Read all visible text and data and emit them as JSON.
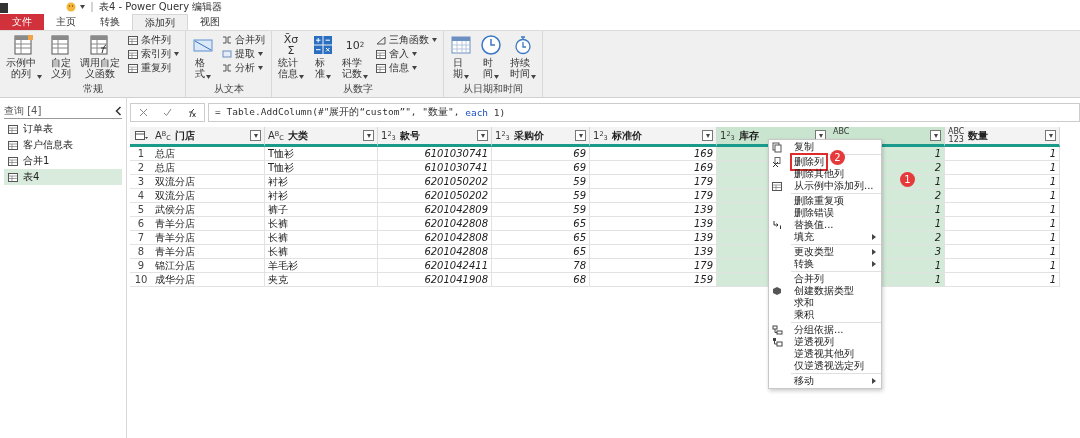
{
  "window": {
    "title": "表4 - Power Query 编辑器"
  },
  "tabs": [
    {
      "label": "文件",
      "kind": "file",
      "selected": false
    },
    {
      "label": "主页",
      "kind": "tab",
      "selected": false
    },
    {
      "label": "转换",
      "kind": "tab",
      "selected": false
    },
    {
      "label": "添加列",
      "kind": "tab",
      "selected": true
    },
    {
      "label": "视图",
      "kind": "tab",
      "selected": false
    }
  ],
  "ribbon": {
    "groups": [
      {
        "label": "常规",
        "large": [
          {
            "label": "示例中的列",
            "dropdown": true
          },
          {
            "label": "自定义列",
            "dropdown": false
          },
          {
            "label": "调用自定义函数",
            "dropdown": false
          }
        ],
        "small": [
          {
            "label": "条件列",
            "dropdown": false
          },
          {
            "label": "索引列",
            "dropdown": true
          },
          {
            "label": "重复列",
            "dropdown": false
          }
        ]
      },
      {
        "label": "从文本",
        "large": [
          {
            "label": "格式",
            "dropdown": true
          }
        ],
        "small": [
          {
            "label": "合并列",
            "dropdown": false
          },
          {
            "label": "提取",
            "dropdown": true
          },
          {
            "label": "分析",
            "dropdown": true
          }
        ]
      },
      {
        "label": "从数字",
        "large": [
          {
            "label": "统计信息",
            "icon_text": "X̄σ\nΣ",
            "dropdown": true
          },
          {
            "label": "标准",
            "dropdown": true
          },
          {
            "label": "科学记数",
            "icon_text": "10$^{2}$",
            "dropdown": true
          }
        ],
        "small": [
          {
            "label": "三角函数",
            "dropdown": true
          },
          {
            "label": "舍入",
            "dropdown": true
          },
          {
            "label": "信息",
            "dropdown": true
          }
        ]
      },
      {
        "label": "从日期和时间",
        "large": [
          {
            "label": "日期",
            "dropdown": true
          },
          {
            "label": "时间",
            "dropdown": true
          },
          {
            "label": "持续时间",
            "dropdown": true
          }
        ]
      }
    ]
  },
  "queries": {
    "title": "查询 [4]",
    "items": [
      {
        "label": "订单表",
        "selected": false
      },
      {
        "label": "客户信息表",
        "selected": false
      },
      {
        "label": "合并1",
        "selected": false
      },
      {
        "label": "表4",
        "selected": true
      }
    ]
  },
  "formula": [
    {
      "text": "= Table.AddColumn(#\"展开的“custom”\", \"数量\", ",
      "kind": "code"
    },
    {
      "text": "each",
      "kind": "keyword"
    },
    {
      "text": " 1)",
      "kind": "code"
    }
  ],
  "table": {
    "columns": [
      {
        "name": "门店",
        "type_label": "A$^{B}$$_{C}$",
        "kind": "text",
        "selected": false,
        "covered": false
      },
      {
        "name": "大类",
        "type_label": "A$^{B}$$_{C}$",
        "kind": "text",
        "selected": false,
        "covered": false
      },
      {
        "name": "款号",
        "type_label": "1$^{2}$$_{3}$",
        "kind": "number",
        "selected": false,
        "covered": false
      },
      {
        "name": "采购价",
        "type_label": "1$^{2}$$_{3}$",
        "kind": "number",
        "selected": false,
        "covered": false
      },
      {
        "name": "标准价",
        "type_label": "1$^{2}$$_{3}$",
        "kind": "number",
        "selected": false,
        "covered": false
      },
      {
        "name": "库存",
        "type_label": "1$^{2}$$_{3}$",
        "kind": "number",
        "selected": true,
        "covered": true
      },
      {
        "type_label": "ABC",
        "kind": "any",
        "selected": true,
        "covered": false
      },
      {
        "name": "数量",
        "type_label": "ABC\n123",
        "kind": "any",
        "selected": false,
        "covered": false
      }
    ],
    "rows": [
      {
        "n": "1",
        "cells": [
          "总店",
          "T恤衫",
          "6101030741",
          "69",
          "169",
          "1",
          "1"
        ]
      },
      {
        "n": "2",
        "cells": [
          "总店",
          "T恤衫",
          "6101030741",
          "69",
          "169",
          "2",
          "1"
        ]
      },
      {
        "n": "3",
        "cells": [
          "双流分店",
          "衬衫",
          "6201050202",
          "59",
          "179",
          "1",
          "1"
        ]
      },
      {
        "n": "4",
        "cells": [
          "双流分店",
          "衬衫",
          "6201050202",
          "59",
          "179",
          "2",
          "1"
        ]
      },
      {
        "n": "5",
        "cells": [
          "武侯分店",
          "裤子",
          "6201042809",
          "59",
          "139",
          "1",
          "1"
        ]
      },
      {
        "n": "6",
        "cells": [
          "青羊分店",
          "长裤",
          "6201042808",
          "65",
          "139",
          "1",
          "1"
        ]
      },
      {
        "n": "7",
        "cells": [
          "青羊分店",
          "长裤",
          "6201042808",
          "65",
          "139",
          "2",
          "1"
        ]
      },
      {
        "n": "8",
        "cells": [
          "青羊分店",
          "长裤",
          "6201042808",
          "65",
          "139",
          "3",
          "1"
        ]
      },
      {
        "n": "9",
        "cells": [
          "锦江分店",
          "羊毛衫",
          "6201042411",
          "78",
          "179",
          "1",
          "1"
        ]
      },
      {
        "n": "10",
        "cells": [
          "成华分店",
          "夹克",
          "6201041908",
          "68",
          "159",
          "1",
          "1"
        ]
      }
    ]
  },
  "context_menu": [
    {
      "kind": "item",
      "label": "复制",
      "submenu": false,
      "highlighted": false
    },
    {
      "kind": "separator"
    },
    {
      "kind": "item",
      "label": "删除列",
      "submenu": false,
      "highlighted": true
    },
    {
      "kind": "item",
      "label": "删除其他列",
      "submenu": false,
      "highlighted": false
    },
    {
      "kind": "item",
      "label": "从示例中添加列...",
      "submenu": false,
      "highlighted": false
    },
    {
      "kind": "separator"
    },
    {
      "kind": "item",
      "label": "删除重复项",
      "submenu": false,
      "highlighted": false
    },
    {
      "kind": "item",
      "label": "删除错误",
      "submenu": false,
      "highlighted": false
    },
    {
      "kind": "item",
      "label": "替换值...",
      "submenu": false,
      "highlighted": false
    },
    {
      "kind": "item",
      "label": "填充",
      "submenu": true,
      "highlighted": false
    },
    {
      "kind": "separator"
    },
    {
      "kind": "item",
      "label": "更改类型",
      "submenu": true,
      "highlighted": false
    },
    {
      "kind": "item",
      "label": "转换",
      "submenu": true,
      "highlighted": false
    },
    {
      "kind": "separator"
    },
    {
      "kind": "item",
      "label": "合并列",
      "submenu": false,
      "highlighted": false
    },
    {
      "kind": "item",
      "label": "创建数据类型",
      "submenu": false,
      "highlighted": false
    },
    {
      "kind": "item",
      "label": "求和",
      "submenu": false,
      "highlighted": false
    },
    {
      "kind": "item",
      "label": "乘积",
      "submenu": false,
      "highlighted": false
    },
    {
      "kind": "separator"
    },
    {
      "kind": "item",
      "label": "分组依据...",
      "submenu": false,
      "highlighted": false
    },
    {
      "kind": "item",
      "label": "逆透视列",
      "submenu": false,
      "highlighted": false
    },
    {
      "kind": "item",
      "label": "逆透视其他列",
      "submenu": false,
      "highlighted": false
    },
    {
      "kind": "item",
      "label": "仅逆透视选定列",
      "submenu": false,
      "highlighted": false
    },
    {
      "kind": "separator"
    },
    {
      "kind": "item",
      "label": "移动",
      "submenu": true,
      "highlighted": false
    }
  ],
  "annotations": [
    {
      "label": "2"
    },
    {
      "label": "1"
    }
  ]
}
